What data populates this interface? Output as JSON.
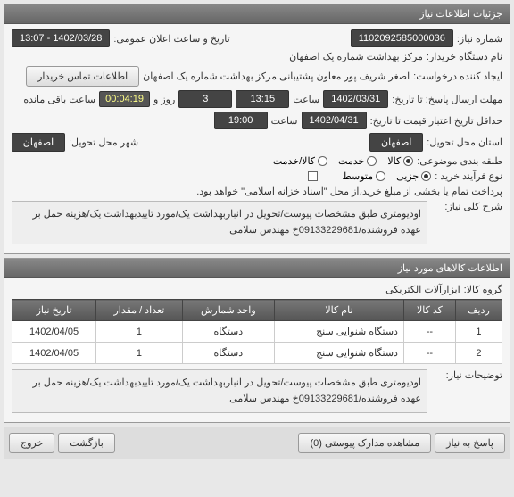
{
  "panels": {
    "info": {
      "title": "جزئیات اطلاعات نیاز"
    },
    "items": {
      "title": "اطلاعات کالاهای مورد نیاز"
    }
  },
  "fields": {
    "need_no_label": "شماره نیاز:",
    "need_no": "1102092585000036",
    "buyer_label": "نام دستگاه خریدار:",
    "buyer": "مرکز بهداشت شماره یک اصفهان",
    "requester_label": "ایجاد کننده درخواست:",
    "requester": "اصغر شریف پور معاون پشتیبانی مرکز بهداشت شماره یک اصفهان",
    "contact_btn": "اطلاعات تماس خریدار",
    "announce_label": "تاریخ و ساعت اعلان عمومی:",
    "announce": "1402/03/28 - 13:07",
    "deadline_label": "مهلت ارسال پاسخ: تا تاریخ:",
    "deadline_date": "1402/03/31",
    "time_label": "ساعت",
    "deadline_time": "13:15",
    "day_label": "روز و",
    "days": "3",
    "remaining_label": "ساعت باقی مانده",
    "remaining": "00:04:19",
    "validity_label": "حداقل تاریخ اعتبار قیمت تا تاریخ:",
    "validity_date": "1402/04/31",
    "validity_time": "19:00",
    "city_need_label": "شهر محل تحویل:",
    "city_need": "اصفهان",
    "province_need_label": "استان محل تحویل:",
    "province_need": "اصفهان",
    "category_label": "طبقه بندی موضوعی:",
    "process_label": "نوع فرآیند خرید :",
    "payment_note": "پرداخت تمام یا بخشی از مبلغ خرید،از محل \"اسناد خزانه اسلامی\" خواهد بود.",
    "desc_label": "شرح کلی نیاز:",
    "desc": "اودیومتری طبق مشخصات پیوست/تحویل در انباربهداشت یک/مورد تاییدبهداشت یک/هزینه حمل بر عهده فروشنده/09133229681خ مهندس سلامی",
    "group_label": "گروه کالا:",
    "group": "ابزارآلات الکتریکی",
    "notes_label": "توضیحات نیاز:",
    "notes": "اودیومتری طبق مشخصات پیوست/تحویل در انباربهداشت یک/مورد تاییدبهداشت یک/هزینه حمل بر عهده فروشنده/09133229681خ مهندس سلامی"
  },
  "categories": {
    "goods": "کالا",
    "services": "خدمت",
    "both": "کالا/خدمت"
  },
  "process": {
    "partial": "جزیی",
    "medium": "متوسط"
  },
  "table": {
    "headers": {
      "row": "ردیف",
      "code": "کد کالا",
      "name": "نام کالا",
      "unit": "واحد شمارش",
      "qty": "تعداد / مقدار",
      "date": "تاریخ نیاز"
    },
    "rows": [
      {
        "row": "1",
        "code": "--",
        "name": "دستگاه شنوایی سنج",
        "unit": "دستگاه",
        "qty": "1",
        "date": "1402/04/05"
      },
      {
        "row": "2",
        "code": "--",
        "name": "دستگاه شنوایی سنج",
        "unit": "دستگاه",
        "qty": "1",
        "date": "1402/04/05"
      }
    ]
  },
  "footer": {
    "respond": "پاسخ به نیاز",
    "attachments": "مشاهده مدارک پیوستی (0)",
    "back": "بازگشت",
    "exit": "خروج"
  }
}
